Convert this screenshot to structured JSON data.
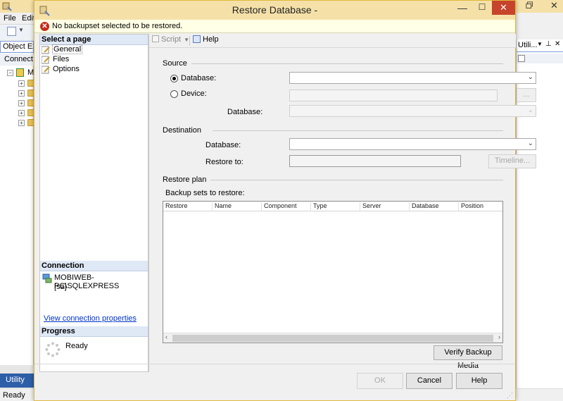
{
  "background_app": {
    "menu": [
      "File",
      "Edit"
    ],
    "object_explorer": {
      "title": "Object Exp",
      "connect_label": "Connect",
      "root_label": "M"
    },
    "right_panel": {
      "title": "Utili..."
    },
    "utility_tab": "Utility",
    "status": "Ready"
  },
  "dialog": {
    "title": "Restore Database -",
    "message": "No backupset selected to be restored.",
    "select_page": {
      "header": "Select a page",
      "items": [
        {
          "label": "General",
          "selected": true
        },
        {
          "label": "Files"
        },
        {
          "label": "Options"
        }
      ]
    },
    "connection": {
      "header": "Connection",
      "server": "MOBIWEB-PC\\SQLEXPRESS",
      "user": "[sa]",
      "view_link": "View connection properties"
    },
    "progress": {
      "header": "Progress",
      "status": "Ready"
    },
    "toolbar": {
      "script_label": "Script",
      "help_label": "Help"
    },
    "source": {
      "label": "Source",
      "database_label": "Database:",
      "device_label": "Device:",
      "device_browse_label": "...",
      "device_database_label": "Database:"
    },
    "destination": {
      "label": "Destination",
      "database_label": "Database:",
      "restore_to_label": "Restore to:",
      "timeline_label": "Timeline..."
    },
    "restore_plan": {
      "label": "Restore plan",
      "backup_sets_label": "Backup sets to restore:",
      "columns": [
        "Restore",
        "Name",
        "Component",
        "Type",
        "Server",
        "Database",
        "Position"
      ]
    },
    "verify_button": "Verify Backup Media",
    "buttons": {
      "ok": "OK",
      "cancel": "Cancel",
      "help": "Help"
    }
  },
  "colors": {
    "titlebar": "#f5e1a8",
    "close_button": "#c7432c",
    "error_icon": "#c42b1c",
    "link": "#0033cc"
  }
}
